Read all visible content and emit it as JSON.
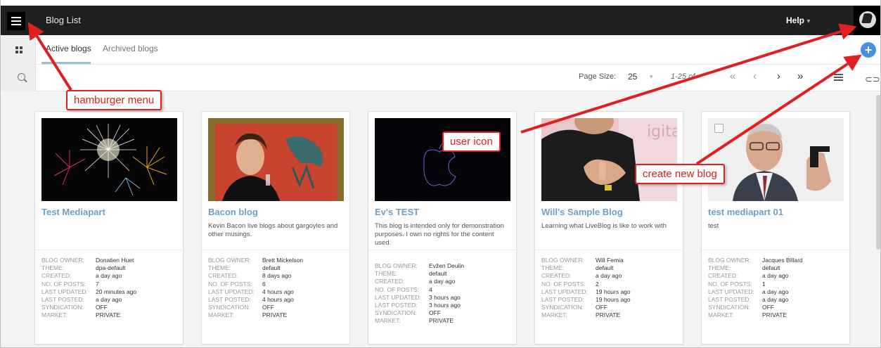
{
  "header": {
    "title": "Blog List",
    "help_label": "Help",
    "help_caret": "▾"
  },
  "tabs": [
    {
      "label": "Active blogs"
    },
    {
      "label": "Archived blogs"
    }
  ],
  "toolbar": {
    "page_size_label": "Page Size:",
    "page_size_value": "25",
    "page_size_caret": "▾",
    "page_range": "1-25 of",
    "first": "«",
    "prev": "‹",
    "next": "›",
    "last": "»",
    "add_symbol": "+",
    "link_symbol": "⊂⊃"
  },
  "meta_labels": {
    "owner": "BLOG OWNER:",
    "theme": "THEME:",
    "created": "CREATED:",
    "posts": "NO. OF POSTS:",
    "updated": "LAST UPDATED:",
    "posted": "LAST POSTED:",
    "syndication": "SYNDICATION:",
    "market": "MARKET:"
  },
  "blogs": [
    {
      "title": "Test Mediapart",
      "description": "",
      "owner": "Donatien Huet",
      "theme": "dpa-default",
      "created": "a day ago",
      "posts": "7",
      "updated": "20 minutes ago",
      "posted": "a day ago",
      "syndication": "OFF",
      "market": "PRIVATE"
    },
    {
      "title": "Bacon blog",
      "description": "Kevin Bacon live blogs about gargoyles and other musings.",
      "owner": "Brett Mickelson",
      "theme": "default",
      "created": "8 days ago",
      "posts": "6",
      "updated": "4 hours ago",
      "posted": "4 hours ago",
      "syndication": "OFF",
      "market": "PRIVATE"
    },
    {
      "title": "Ev's TEST",
      "description": "This blog is intended only for demonstration purposes. I own no rights for the content used.",
      "owner": "Evžen Deulin",
      "theme": "default",
      "created": "a day ago",
      "posts": "4",
      "updated": "3 hours ago",
      "posted": "3 hours ago",
      "syndication": "OFF",
      "market": "PRIVATE"
    },
    {
      "title": "Will's Sample Blog",
      "description": "Learning what LiveBlog is like to work with",
      "owner": "Will Femia",
      "theme": "default",
      "created": "a day ago",
      "posts": "2",
      "updated": "19 hours ago",
      "posted": "19 hours ago",
      "syndication": "OFF",
      "market": "PRIVATE",
      "thumb_text": "igital"
    },
    {
      "title": "test mediapart 01",
      "description": "test",
      "owner": "Jacques Billard",
      "theme": "default",
      "created": "a day ago",
      "posts": "1",
      "updated": "a day ago",
      "posted": "a day ago",
      "syndication": "OFF",
      "market": "PRIVATE"
    }
  ],
  "annotations": {
    "hamburger": "hamburger menu",
    "user": "user icon",
    "create": "create new blog"
  },
  "colors": {
    "header_bg": "#1f1f1f",
    "accent_blue": "#4a90e2",
    "title_blue": "#6d9fc6",
    "annotation_red": "#e02020"
  },
  "icons": [
    "hamburger-icon",
    "grid-view-icon",
    "search-icon",
    "add-icon",
    "user-avatar-icon",
    "list-view-icon",
    "link-icon"
  ]
}
